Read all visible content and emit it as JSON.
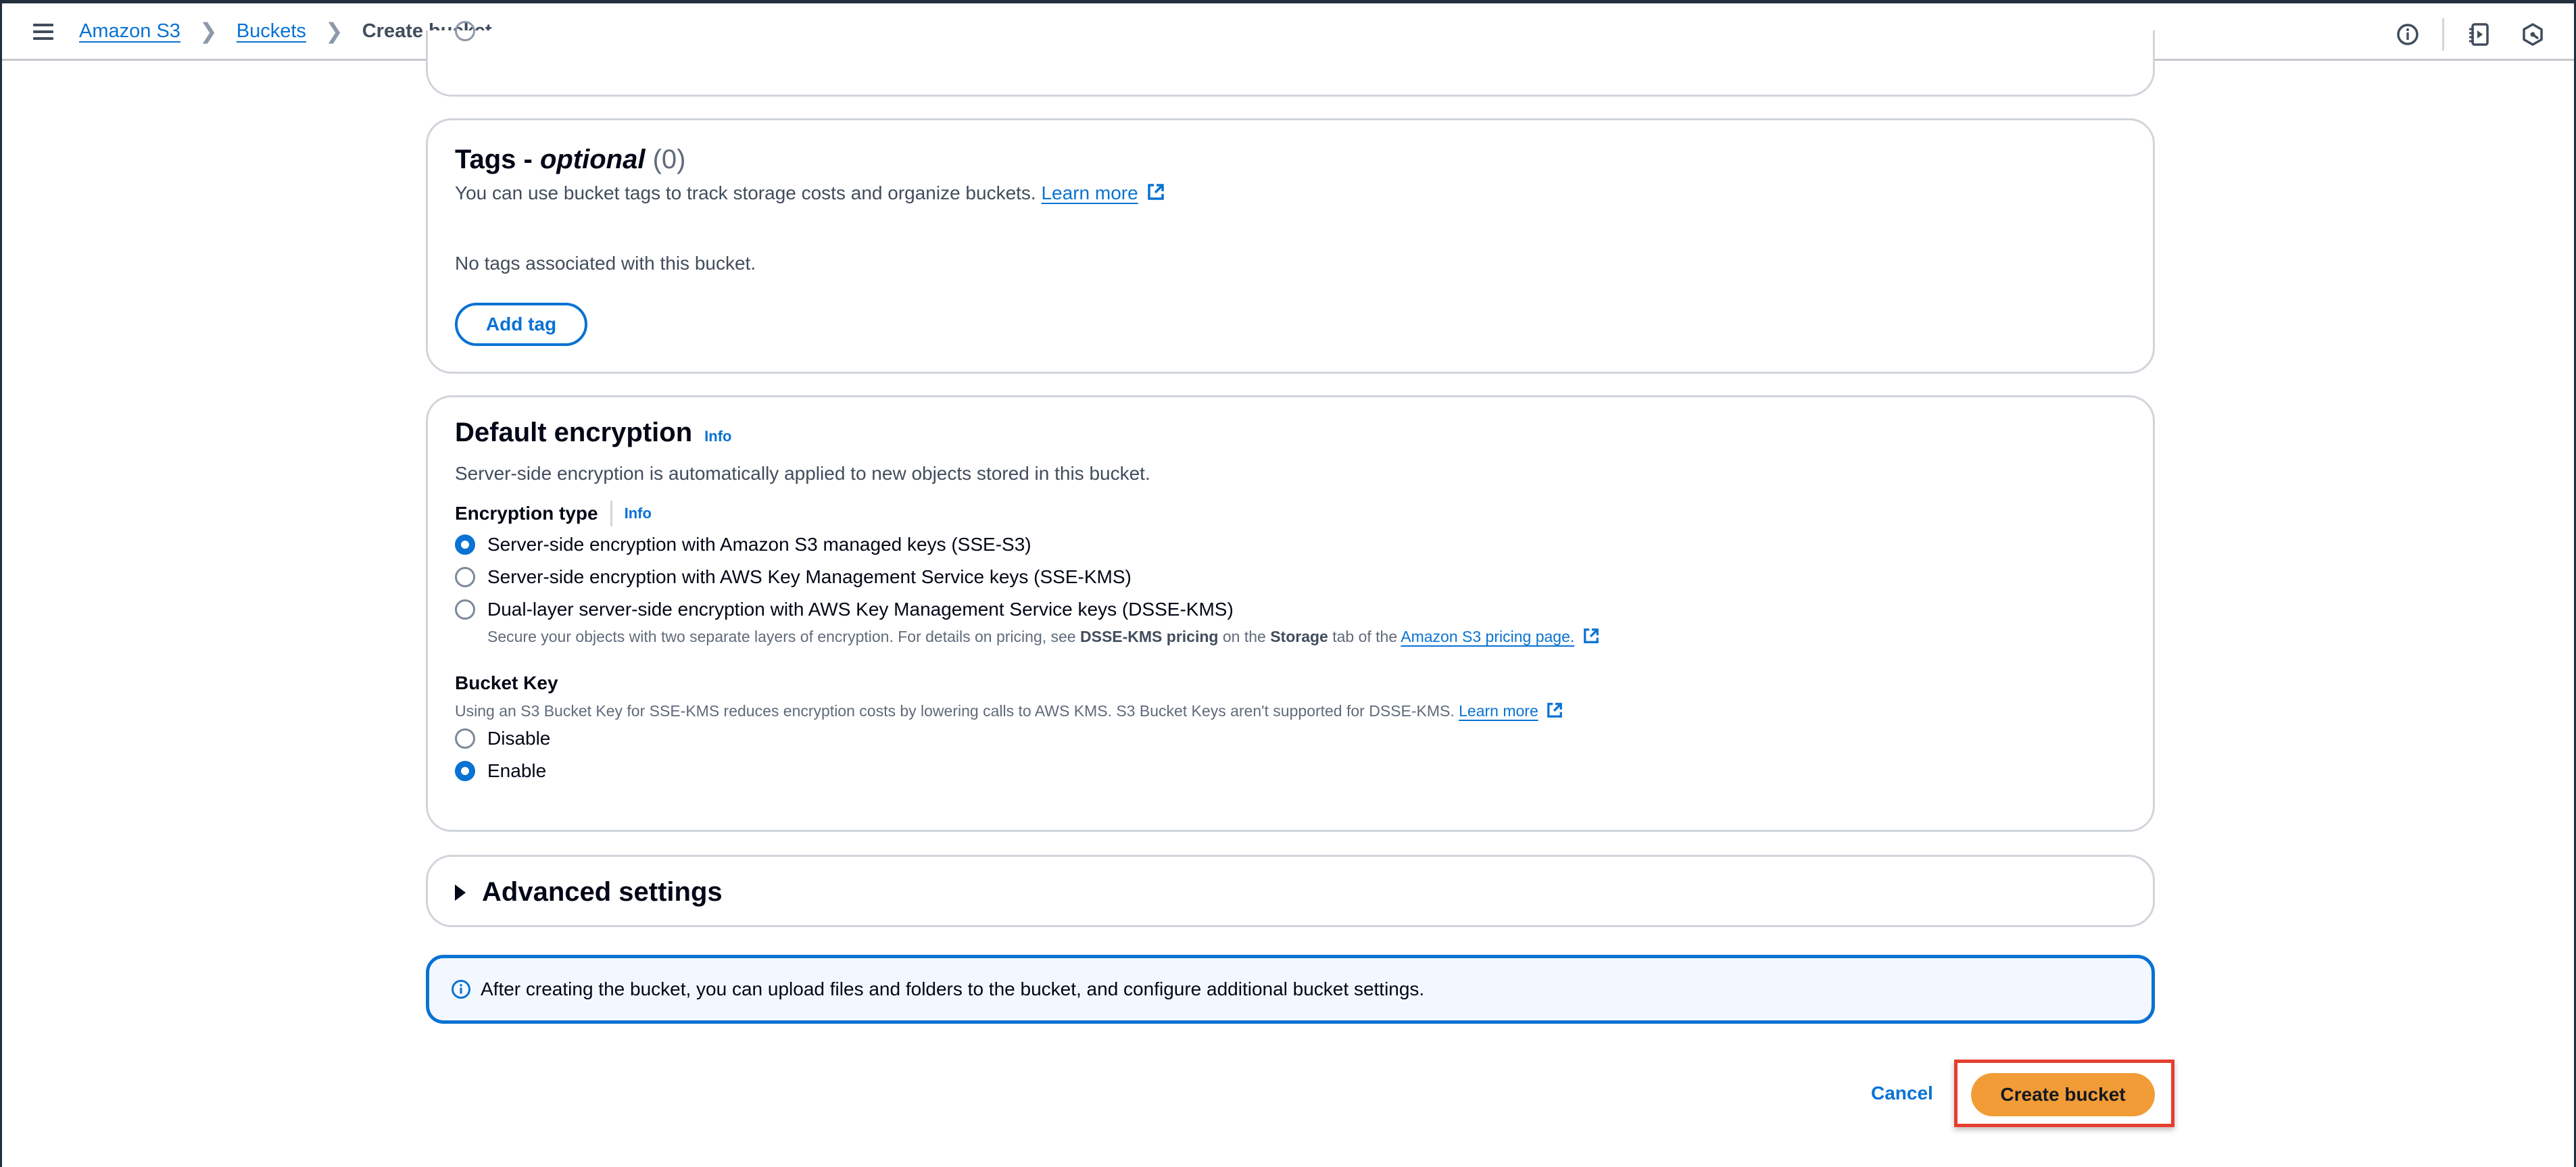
{
  "header": {
    "menu_icon": "hamburger-menu-icon",
    "breadcrumb": [
      {
        "label": "Amazon S3",
        "link": true
      },
      {
        "label": "Buckets",
        "link": true
      },
      {
        "label": "Create bucket",
        "link": false
      }
    ],
    "icons": [
      "info-circle-icon",
      "cloudshell-notebook-icon",
      "settings-hexagon-icon"
    ]
  },
  "tags": {
    "title": "Tags - ",
    "title_italic": "optional",
    "count": "(0)",
    "description": "You can use bucket tags to track storage costs and organize buckets.",
    "learn_more": "Learn more",
    "empty_text": "No tags associated with this bucket.",
    "add_button": "Add tag"
  },
  "encryption": {
    "title": "Default encryption",
    "info": "Info",
    "description": "Server-side encryption is automatically applied to new objects stored in this bucket.",
    "type_label": "Encryption type",
    "type_info": "Info",
    "options": [
      {
        "label": "Server-side encryption with Amazon S3 managed keys (SSE-S3)",
        "checked": true
      },
      {
        "label": "Server-side encryption with AWS Key Management Service keys (SSE-KMS)",
        "checked": false
      },
      {
        "label": "Dual-layer server-side encryption with AWS Key Management Service keys (DSSE-KMS)",
        "checked": false
      }
    ],
    "dsse_sub": {
      "prefix": "Secure your objects with two separate layers of encryption. For details on pricing, see ",
      "bold1": "DSSE-KMS pricing",
      "mid": " on the ",
      "bold2": "Storage",
      "suffix": " tab of the ",
      "link": "Amazon S3 pricing page."
    },
    "bucket_key": {
      "label": "Bucket Key",
      "description": "Using an S3 Bucket Key for SSE-KMS reduces encryption costs by lowering calls to AWS KMS. S3 Bucket Keys aren't supported for DSSE-KMS.",
      "learn_more": "Learn more",
      "options": [
        {
          "label": "Disable",
          "checked": false
        },
        {
          "label": "Enable",
          "checked": true
        }
      ]
    }
  },
  "advanced": {
    "title": "Advanced settings",
    "expanded": false
  },
  "info_alert": {
    "text": "After creating the bucket, you can upload files and folders to the bucket, and configure additional bucket settings."
  },
  "actions": {
    "cancel": "Cancel",
    "create": "Create bucket"
  },
  "colors": {
    "link": "#0972d3",
    "primary_button": "#f29c38",
    "highlight": "#e53e2e"
  }
}
